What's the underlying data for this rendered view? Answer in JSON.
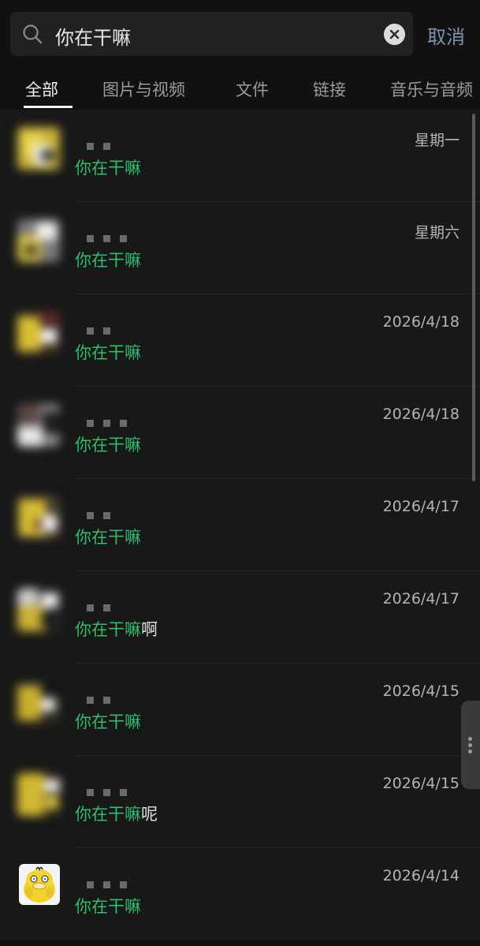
{
  "search": {
    "query": "你在干嘛",
    "cancel_label": "取消"
  },
  "tabs": [
    {
      "label": "全部",
      "active": true
    },
    {
      "label": "图片与视频",
      "active": false
    },
    {
      "label": "文件",
      "active": false
    },
    {
      "label": "链接",
      "active": false
    },
    {
      "label": "音乐与音频",
      "active": false
    }
  ],
  "results": [
    {
      "match": "你在干嘛",
      "suffix": "",
      "date": "星期一"
    },
    {
      "match": "你在干嘛",
      "suffix": "",
      "date": "星期六"
    },
    {
      "match": "你在干嘛",
      "suffix": "",
      "date": "2026/4/18"
    },
    {
      "match": "你在干嘛",
      "suffix": "",
      "date": "2026/4/18"
    },
    {
      "match": "你在干嘛",
      "suffix": "",
      "date": "2026/4/17"
    },
    {
      "match": "你在干嘛",
      "suffix": "啊",
      "date": "2026/4/17"
    },
    {
      "match": "你在干嘛",
      "suffix": "",
      "date": "2026/4/15"
    },
    {
      "match": "你在干嘛",
      "suffix": "呢",
      "date": "2026/4/15"
    },
    {
      "match": "你在干嘛",
      "suffix": "",
      "date": "2026/4/14"
    }
  ],
  "colors": {
    "background": "#111111",
    "match_text": "#2fbe6b",
    "cancel_text": "#7f93ae",
    "avatar_yellow": "#e8c21a"
  },
  "icons": {
    "search": "search-icon",
    "clear": "close-circle-icon",
    "handle": "more-vertical-icon"
  }
}
